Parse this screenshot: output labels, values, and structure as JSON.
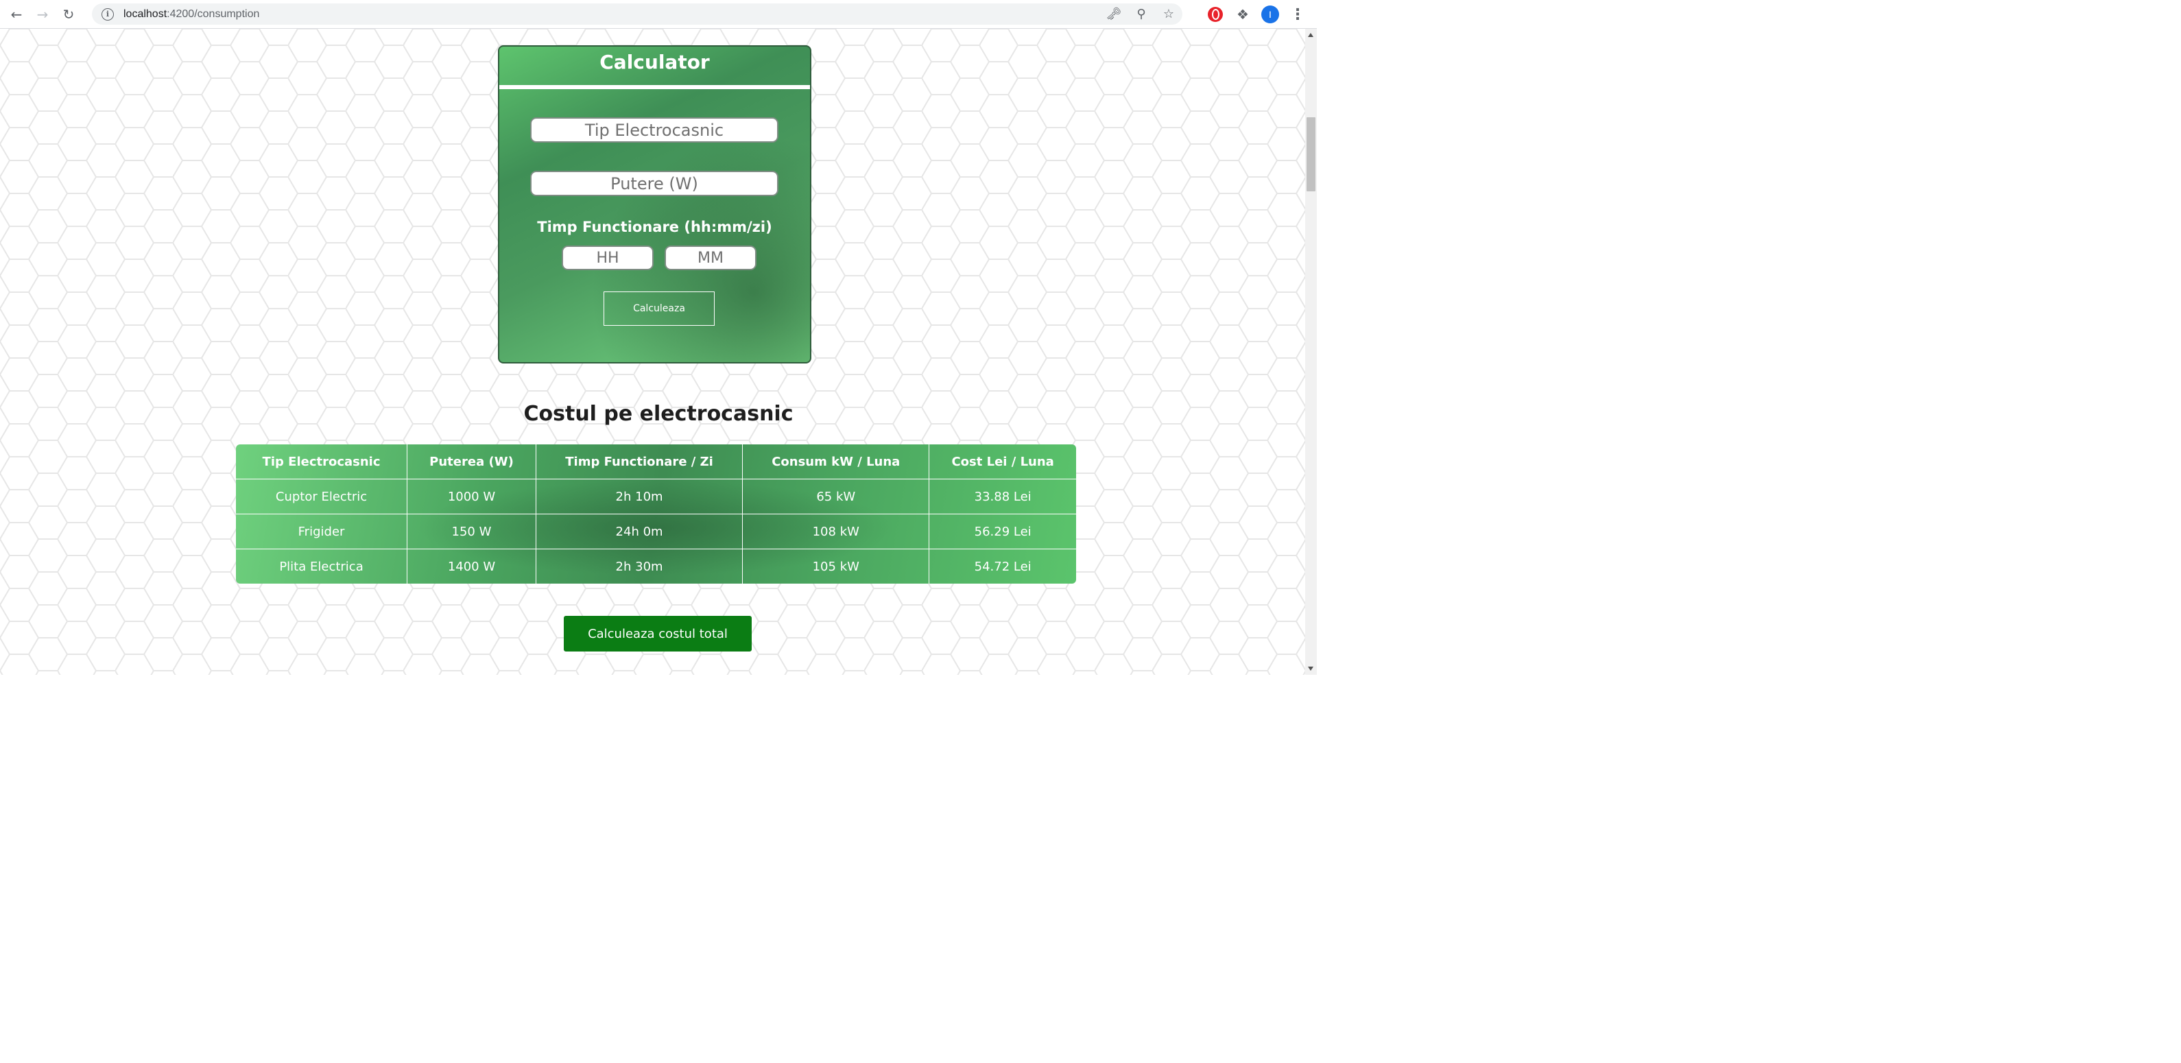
{
  "browser": {
    "url_host": "localhost",
    "url_path": ":4200/consumption",
    "profile_initial": "I"
  },
  "calculator": {
    "title": "Calculator",
    "appliance_placeholder": "Tip Electrocasnic",
    "power_placeholder": "Putere (W)",
    "time_label": "Timp Functionare (hh:mm/zi)",
    "hours_placeholder": "HH",
    "minutes_placeholder": "MM",
    "calculate_label": "Calculeaza"
  },
  "results": {
    "title": "Costul pe electrocasnic",
    "columns": [
      "Tip Electrocasnic",
      "Puterea (W)",
      "Timp Functionare / Zi",
      "Consum kW / Luna",
      "Cost Lei / Luna"
    ],
    "rows": [
      [
        "Cuptor Electric",
        "1000 W",
        "2h 10m",
        "65 kW",
        "33.88 Lei"
      ],
      [
        "Frigider",
        "150 W",
        "24h 0m",
        "108 kW",
        "56.29 Lei"
      ],
      [
        "Plita Electrica",
        "1400 W",
        "2h 30m",
        "105 kW",
        "54.72 Lei"
      ]
    ],
    "total_button_label": "Calculeaza costul total"
  },
  "icons": {
    "back": "arrow-left-icon",
    "forward": "arrow-right-icon",
    "reload": "reload-icon",
    "key": "key-icon",
    "zoom": "zoom-icon",
    "bookmark": "star-icon"
  },
  "colors": {
    "accent_green": "#4aa55f",
    "button_green": "#0b7d14"
  }
}
